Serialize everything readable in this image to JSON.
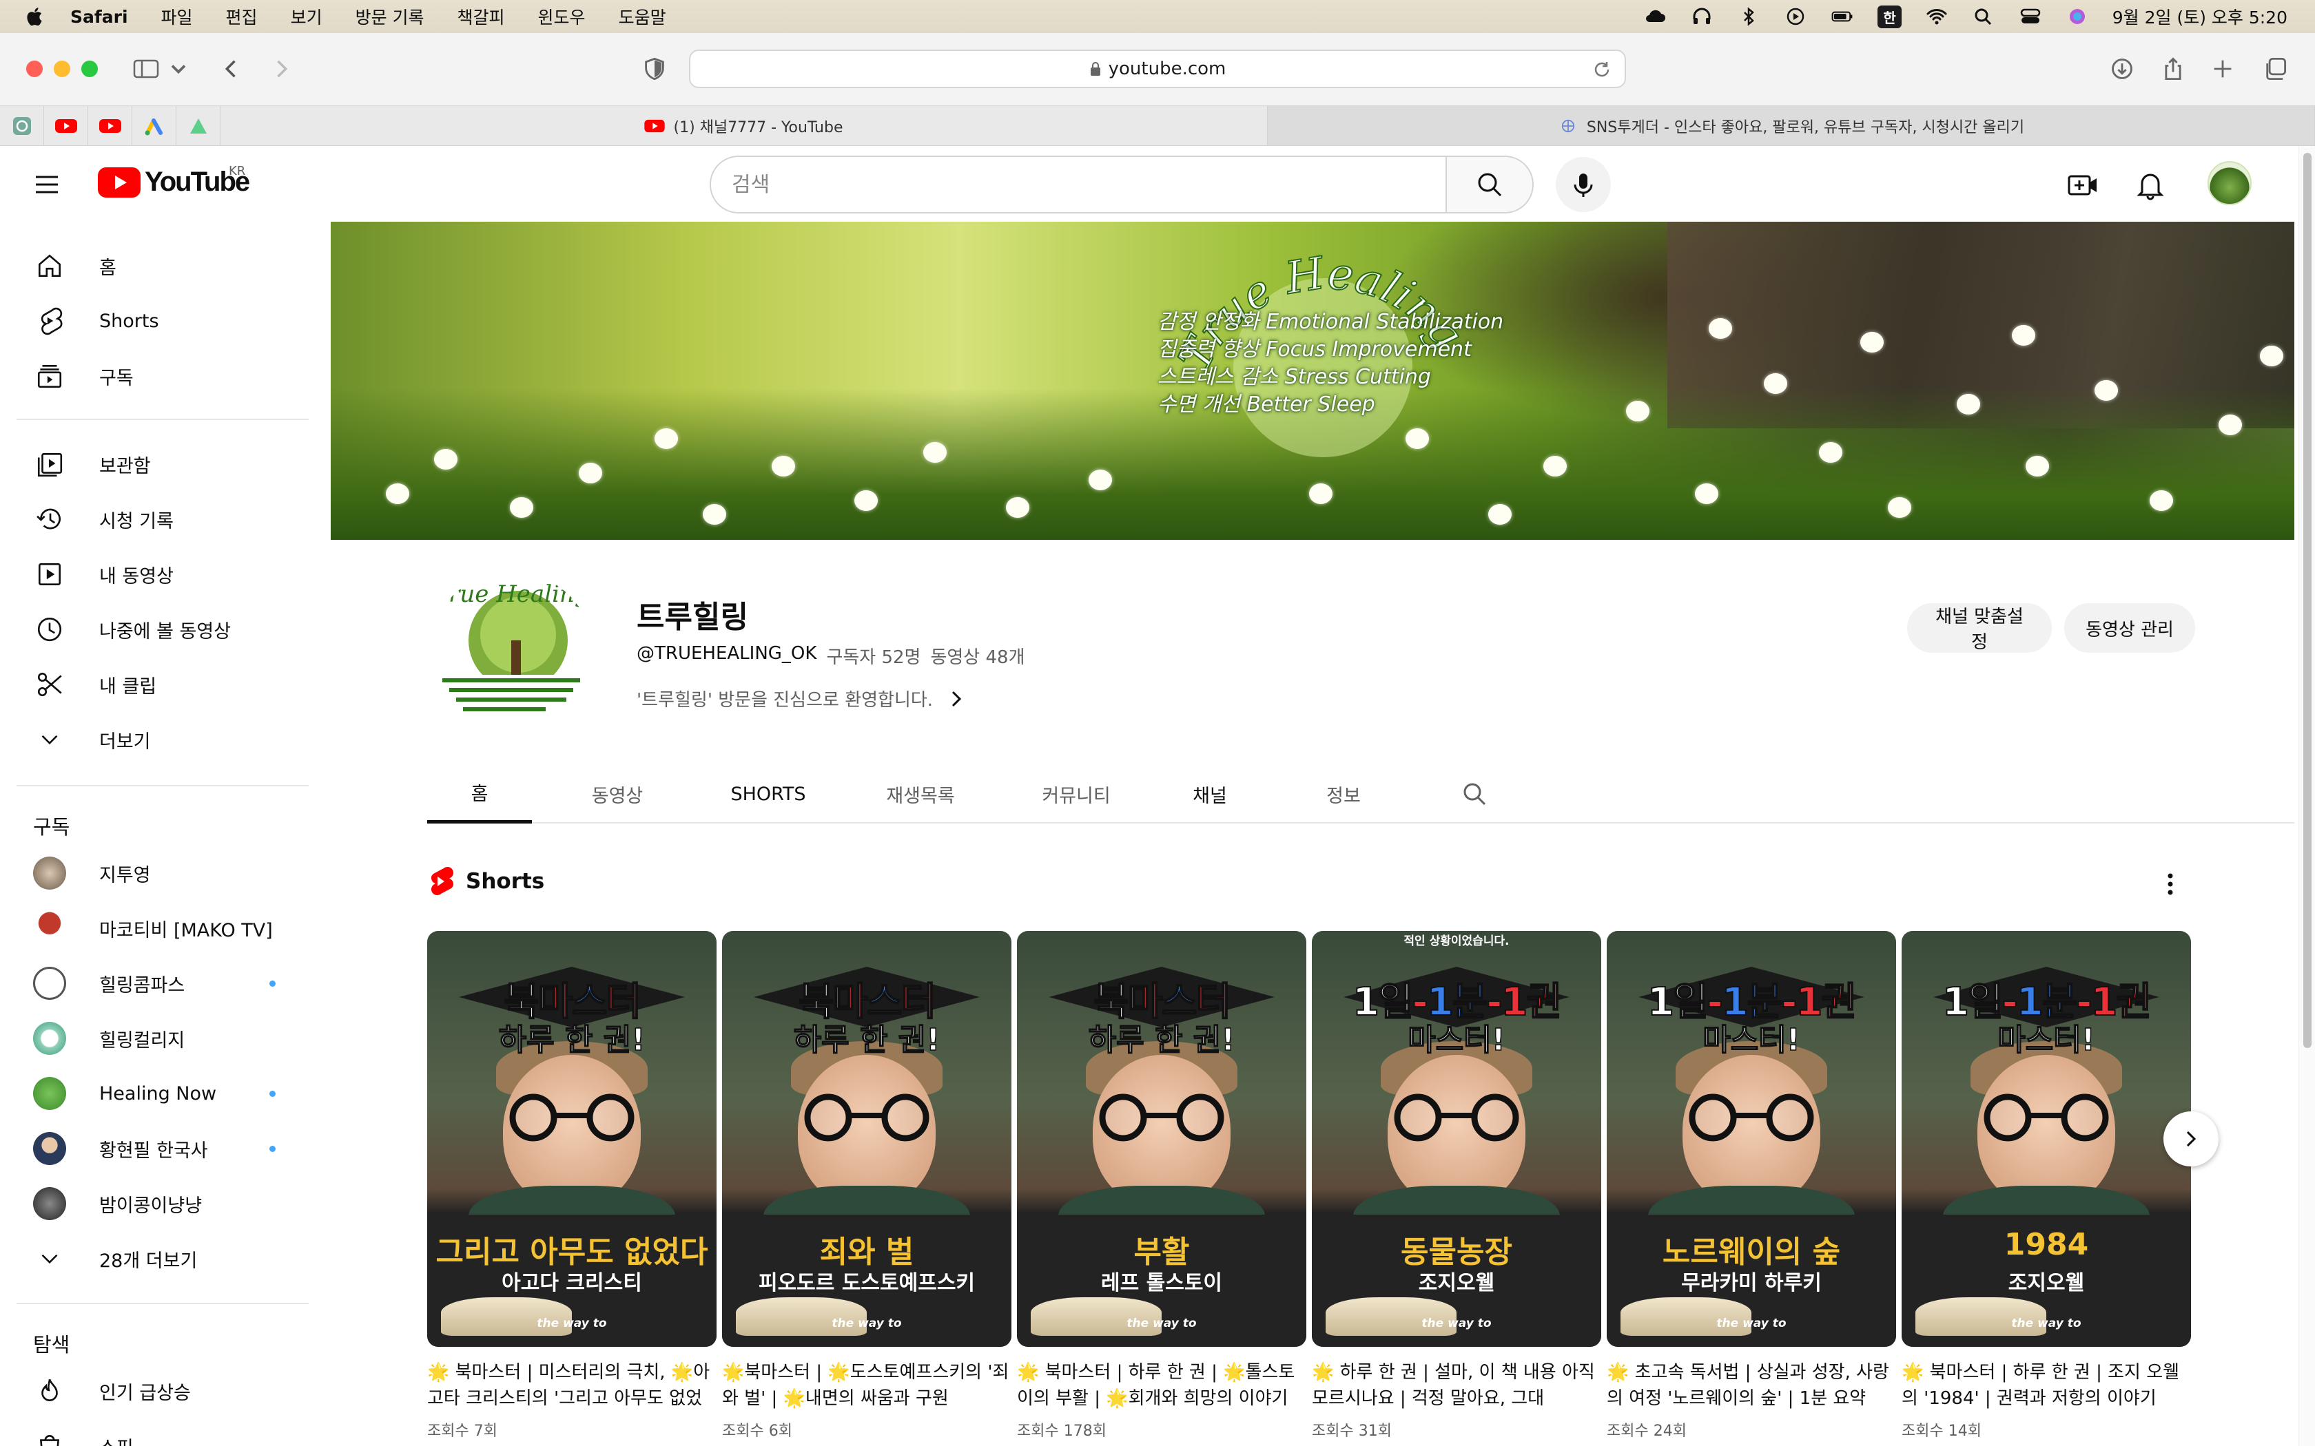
{
  "menubar": {
    "app": "Safari",
    "items": [
      "파일",
      "편집",
      "보기",
      "방문 기록",
      "책갈피",
      "윈도우",
      "도움말"
    ],
    "ime": "한",
    "datetime": "9월 2일 (토) 오후 5:20"
  },
  "browser": {
    "url": "youtube.com",
    "tabs": [
      {
        "title": "(1) 채널7777 - YouTube"
      },
      {
        "title": "SNS투게더 - 인스타 좋아요, 팔로워, 유튜브 구독자, 시청시간 올리기"
      }
    ]
  },
  "youtube": {
    "logo_text": "YouTube",
    "region": "KR",
    "search_placeholder": "검색"
  },
  "sidebar": {
    "primary": [
      {
        "label": "홈",
        "icon": "home-icon"
      },
      {
        "label": "Shorts",
        "icon": "shorts-icon"
      },
      {
        "label": "구독",
        "icon": "subscriptions-icon"
      }
    ],
    "library": [
      {
        "label": "보관함",
        "icon": "library-icon"
      },
      {
        "label": "시청 기록",
        "icon": "history-icon"
      },
      {
        "label": "내 동영상",
        "icon": "my-videos-icon"
      },
      {
        "label": "나중에 볼 동영상",
        "icon": "watch-later-icon"
      },
      {
        "label": "내 클립",
        "icon": "clips-icon"
      },
      {
        "label": "더보기",
        "icon": "chevron-down-icon"
      }
    ],
    "subscriptions_title": "구독",
    "subscriptions": [
      {
        "name": "지투영",
        "new": false,
        "color": "#6b5a4a"
      },
      {
        "name": "마코티비 [MAKO TV]",
        "new": false,
        "color": "#c0392b"
      },
      {
        "name": "힐링콤파스",
        "new": true,
        "color": "#555"
      },
      {
        "name": "힐링컬리지",
        "new": false,
        "color": "#3a9a7a"
      },
      {
        "name": "Healing Now",
        "new": true,
        "color": "#3a8a2a"
      },
      {
        "name": "황현필 한국사",
        "new": true,
        "color": "#2a3a5a"
      },
      {
        "name": "밤이콩이냥냥",
        "new": false,
        "color": "#444"
      }
    ],
    "more_subs": "28개 더보기",
    "explore_title": "탐색",
    "explore": [
      {
        "label": "인기 급상승",
        "icon": "trending-icon"
      },
      {
        "label": "쇼핑",
        "icon": "shopping-icon"
      }
    ]
  },
  "banner": {
    "logo_kr": "트루힐링",
    "logo_en": "True Healing",
    "lines": [
      "감정 안정화 Emotional Stabilization",
      "집중력 향상 Focus Improvement",
      "스트레스 감소 Stress Cutting",
      "수면 개선 Better Sleep"
    ]
  },
  "channel": {
    "name": "트루힐링",
    "handle": "@TRUEHEALING_OK",
    "subscribers": "구독자 52명",
    "videos": "동영상 48개",
    "description": "'트루힐링' 방문을 진심으로 환영합니다.",
    "customize_label": "채널 맞춤설정",
    "manage_label": "동영상 관리"
  },
  "channel_tabs": [
    "홈",
    "동영상",
    "SHORTS",
    "재생목록",
    "커뮤니티",
    "채널",
    "정보"
  ],
  "shelf": {
    "title": "Shorts",
    "items": [
      {
        "top1": [
          "북",
          "마",
          "스",
          "터"
        ],
        "top2": "하루 한 권!",
        "book": "그리고 아무도 없었다",
        "author": "아고다 크리스티",
        "caption": "",
        "title": "🌟 북마스터 | 미스터리의 극치, 🌟아고타 크리스티의 '그리고 아무도 없었다'",
        "views": "조회수 7회"
      },
      {
        "top1": [
          "북",
          "마",
          "스",
          "터"
        ],
        "top2": "하루 한 권!",
        "book": "죄와 벌",
        "author": "피오도르 도스토예프스키",
        "caption": "",
        "title": "🌟북마스터 | 🌟도스토예프스키의 '죄와 벌' | 🌟내면의 싸움과 구원",
        "views": "조회수 6회"
      },
      {
        "top1": [
          "북",
          "마",
          "스",
          "터"
        ],
        "top2": "하루 한 권!",
        "book": "부활",
        "author": "레프 톨스토이",
        "caption": "",
        "title": "🌟 북마스터 | 하루 한 권 | 🌟톨스토이의 부활 | 🌟회개와 희망의 이야기",
        "views": "조회수 178회"
      },
      {
        "top1": [
          "1일",
          "-",
          "1분",
          "-1권"
        ],
        "top2": "마스터!",
        "book": "동물농장",
        "author": "조지오웰",
        "caption": "적인 상황이었습니다.",
        "title": "🌟 하루 한 권 | 설마, 이 책 내용 아직 모르시나요 | 걱정 말아요, 그대",
        "views": "조회수 31회"
      },
      {
        "top1": [
          "1일",
          "-",
          "1분",
          "-1권"
        ],
        "top2": "마스터!",
        "book": "노르웨이의 숲",
        "author": "무라카미 하루키",
        "caption": "",
        "title": "🌟 초고속 독서법 | 상실과 성장, 사랑의 여정 '노르웨이의 숲' | 1분 요약",
        "views": "조회수 24회"
      },
      {
        "top1": [
          "1일",
          "-",
          "1분",
          "-1권"
        ],
        "top2": "마스터!",
        "book": "1984",
        "author": "조지오웰",
        "caption": "",
        "title": "🌟 북마스터 | 하루 한 권 | 조지 오웰의 '1984' | 권력과 저항의 이야기",
        "views": "조회수 14회"
      }
    ],
    "thumb_footer": "the way to"
  },
  "colors": {
    "youtube_red": "#ff0000",
    "new_dot": "#3ea6ff",
    "thumb_title_yellow": "#f5c233"
  }
}
